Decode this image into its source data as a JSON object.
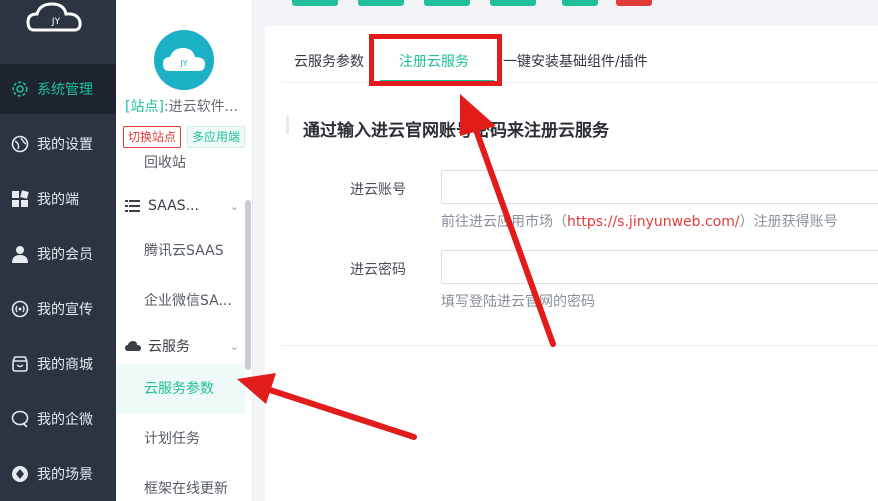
{
  "logo": {
    "text": "JY"
  },
  "left_nav": [
    {
      "label": "系统管理",
      "icon": "gear-icon",
      "active": true
    },
    {
      "label": "我的设置",
      "icon": "globe-icon"
    },
    {
      "label": "我的端",
      "icon": "grid-icon"
    },
    {
      "label": "我的会员",
      "icon": "user-icon"
    },
    {
      "label": "我的宣传",
      "icon": "broadcast-icon"
    },
    {
      "label": "我的商城",
      "icon": "store-icon"
    },
    {
      "label": "我的企微",
      "icon": "chat-icon"
    },
    {
      "label": "我的场景",
      "icon": "diamond-icon"
    }
  ],
  "site": {
    "avatar_text": "JY",
    "tag": "[站点]",
    "name": ":进云软件..."
  },
  "chips": {
    "switch_site": "切换站点",
    "multi_app": "多应用端"
  },
  "sub_nav": {
    "recycle": "回收站",
    "saas_group": "SAAS...",
    "tencent_saas": "腾讯云SAAS",
    "wechat_saas": "企业微信SA...",
    "cloud_group": "云服务",
    "cloud_params": "云服务参数",
    "schedule": "计划任务",
    "framework_update": "框架在线更新"
  },
  "tabs": [
    {
      "label": "云服务参数"
    },
    {
      "label": "注册云服务",
      "active": true
    },
    {
      "label": "一键安装基础组件/插件"
    }
  ],
  "form": {
    "title": "通过输入进云官网账号密码来注册云服务",
    "account_label": "进云账号",
    "account_value": "",
    "account_hint_pre": "前往进云应用市场（",
    "account_hint_link": "https://s.jinyunweb.com/",
    "account_hint_post": "）注册获得账号",
    "password_label": "进云密码",
    "password_value": "",
    "password_hint": "填写登陆进云官网的密码"
  },
  "colors": {
    "accent": "#1fbf9a",
    "nav_bg": "#2b3440",
    "annotation": "#e21b1b",
    "link": "#e23b3b"
  }
}
